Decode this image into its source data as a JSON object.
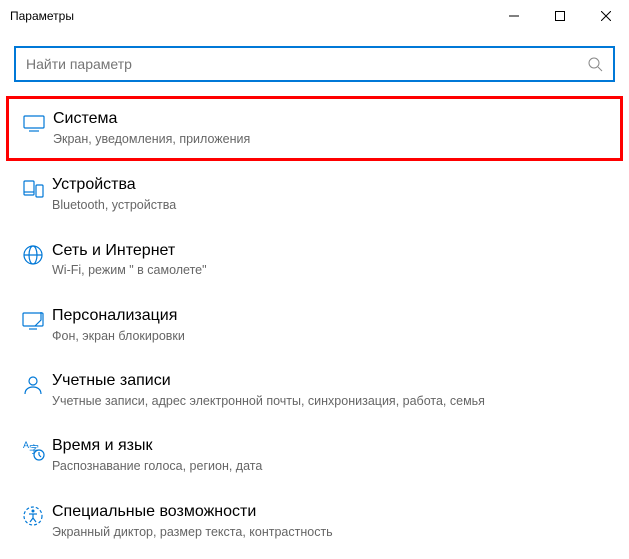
{
  "window": {
    "title": "Параметры"
  },
  "search": {
    "placeholder": "Найти параметр"
  },
  "items": [
    {
      "title": "Система",
      "desc": "Экран, уведомления, приложения"
    },
    {
      "title": "Устройства",
      "desc": "Bluetooth, устройства"
    },
    {
      "title": "Сеть и Интернет",
      "desc": "Wi-Fi, режим \" в самолете\""
    },
    {
      "title": "Персонализация",
      "desc": "Фон, экран блокировки"
    },
    {
      "title": "Учетные записи",
      "desc": "Учетные записи, адрес электронной почты, синхронизация, работа, семья"
    },
    {
      "title": "Время и язык",
      "desc": "Распознавание голоса, регион, дата"
    },
    {
      "title": "Специальные возможности",
      "desc": "Экранный диктор, размер текста, контрастность"
    }
  ]
}
